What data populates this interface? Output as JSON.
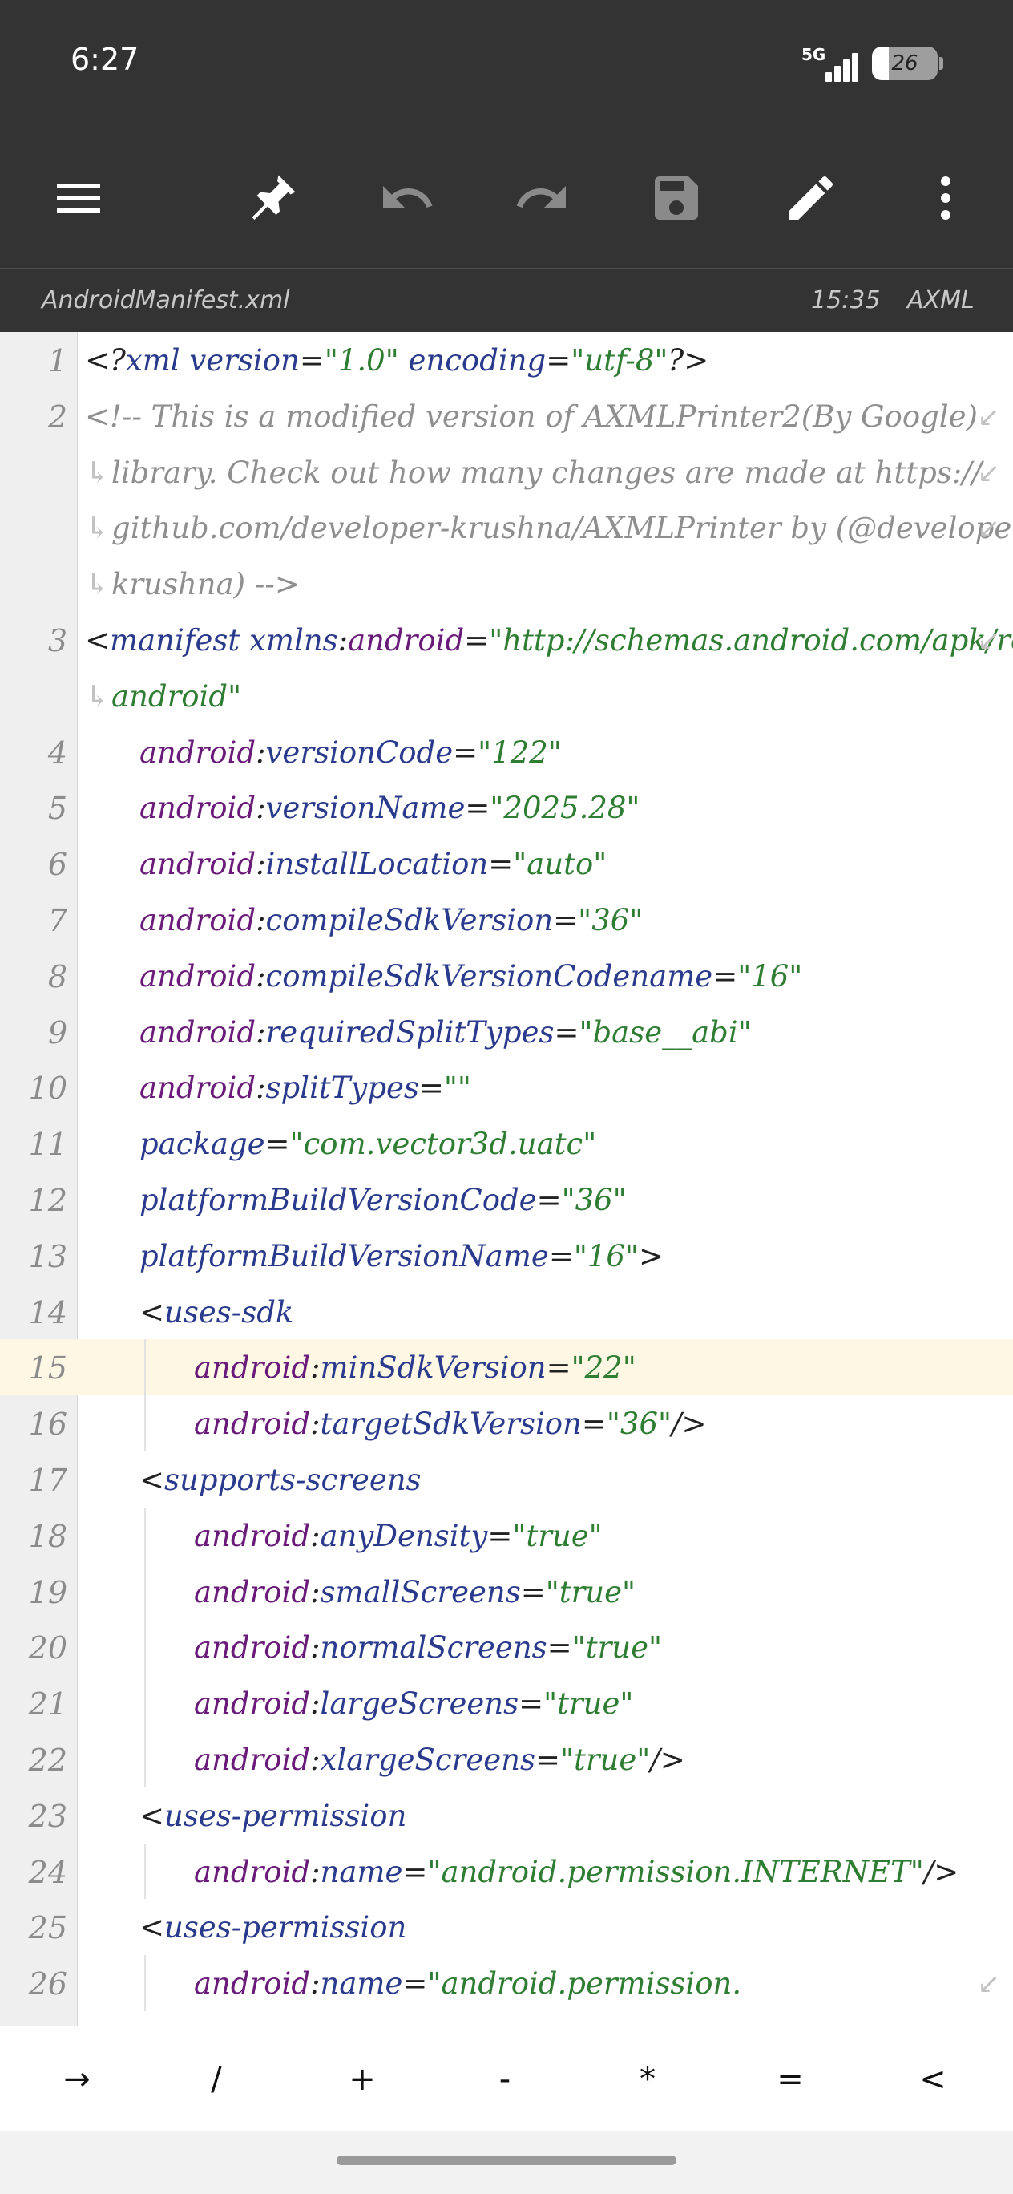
{
  "status_bar": {
    "time": "6:27",
    "network": "5G",
    "battery_level": "26",
    "battery_fraction": 0.26
  },
  "toolbar": {
    "icons": [
      "menu-icon",
      "pin-icon",
      "undo-icon",
      "redo-icon",
      "save-icon",
      "edit-icon",
      "more-vert-icon"
    ]
  },
  "file_bar": {
    "file_name": "AndroidManifest.xml",
    "time": "15:35",
    "file_type": "AXML"
  },
  "editor": {
    "current_line": "15",
    "lines": [
      {
        "n": "1",
        "indent": 0,
        "wrap_start": false,
        "wrap_end": false,
        "tokens": [
          {
            "k": "punct",
            "t": "<?"
          },
          {
            "k": "tag",
            "t": "xml "
          },
          {
            "k": "attr",
            "t": "version"
          },
          {
            "k": "punct",
            "t": "="
          },
          {
            "k": "val",
            "t": "\"1.0\""
          },
          {
            "k": "attr",
            "t": " encoding"
          },
          {
            "k": "punct",
            "t": "="
          },
          {
            "k": "val",
            "t": "\"utf-8\""
          },
          {
            "k": "punct",
            "t": "?>"
          }
        ]
      },
      {
        "n": "2",
        "indent": 0,
        "wrap_start": false,
        "wrap_end": true,
        "tokens": [
          {
            "k": "comment",
            "t": "<!-- This is a modified version of AXMLPrinter2(By Google) "
          }
        ]
      },
      {
        "n": "",
        "indent": 0,
        "wrap_start": true,
        "wrap_end": true,
        "tokens": [
          {
            "k": "comment",
            "t": "library. Check out how many changes are made at https://"
          }
        ]
      },
      {
        "n": "",
        "indent": 0,
        "wrap_start": true,
        "wrap_end": true,
        "tokens": [
          {
            "k": "comment",
            "t": "github.com/developer-krushna/AXMLPrinter by (@developer-"
          }
        ]
      },
      {
        "n": "",
        "indent": 0,
        "wrap_start": true,
        "wrap_end": false,
        "tokens": [
          {
            "k": "comment",
            "t": "krushna) -->"
          }
        ]
      },
      {
        "n": "3",
        "indent": 0,
        "wrap_start": false,
        "wrap_end": true,
        "tokens": [
          {
            "k": "punct",
            "t": "<"
          },
          {
            "k": "tag",
            "t": "manifest "
          },
          {
            "k": "attr",
            "t": "xmlns"
          },
          {
            "k": "punct",
            "t": ":"
          },
          {
            "k": "ns",
            "t": "android"
          },
          {
            "k": "punct",
            "t": "="
          },
          {
            "k": "val",
            "t": "\"http://schemas.android.com/apk/res/"
          }
        ]
      },
      {
        "n": "",
        "indent": 0,
        "wrap_start": true,
        "wrap_end": false,
        "tokens": [
          {
            "k": "val",
            "t": "android\""
          }
        ]
      },
      {
        "n": "4",
        "indent": 1,
        "wrap_start": false,
        "wrap_end": false,
        "tokens": [
          {
            "k": "ns",
            "t": "android"
          },
          {
            "k": "punct",
            "t": ":"
          },
          {
            "k": "attr",
            "t": "versionCode"
          },
          {
            "k": "punct",
            "t": "="
          },
          {
            "k": "val",
            "t": "\"122\""
          }
        ]
      },
      {
        "n": "5",
        "indent": 1,
        "wrap_start": false,
        "wrap_end": false,
        "tokens": [
          {
            "k": "ns",
            "t": "android"
          },
          {
            "k": "punct",
            "t": ":"
          },
          {
            "k": "attr",
            "t": "versionName"
          },
          {
            "k": "punct",
            "t": "="
          },
          {
            "k": "val",
            "t": "\"2025.28\""
          }
        ]
      },
      {
        "n": "6",
        "indent": 1,
        "wrap_start": false,
        "wrap_end": false,
        "tokens": [
          {
            "k": "ns",
            "t": "android"
          },
          {
            "k": "punct",
            "t": ":"
          },
          {
            "k": "attr",
            "t": "installLocation"
          },
          {
            "k": "punct",
            "t": "="
          },
          {
            "k": "val",
            "t": "\"auto\""
          }
        ]
      },
      {
        "n": "7",
        "indent": 1,
        "wrap_start": false,
        "wrap_end": false,
        "tokens": [
          {
            "k": "ns",
            "t": "android"
          },
          {
            "k": "punct",
            "t": ":"
          },
          {
            "k": "attr",
            "t": "compileSdkVersion"
          },
          {
            "k": "punct",
            "t": "="
          },
          {
            "k": "val",
            "t": "\"36\""
          }
        ]
      },
      {
        "n": "8",
        "indent": 1,
        "wrap_start": false,
        "wrap_end": false,
        "tokens": [
          {
            "k": "ns",
            "t": "android"
          },
          {
            "k": "punct",
            "t": ":"
          },
          {
            "k": "attr",
            "t": "compileSdkVersionCodename"
          },
          {
            "k": "punct",
            "t": "="
          },
          {
            "k": "val",
            "t": "\"16\""
          }
        ]
      },
      {
        "n": "9",
        "indent": 1,
        "wrap_start": false,
        "wrap_end": false,
        "tokens": [
          {
            "k": "ns",
            "t": "android"
          },
          {
            "k": "punct",
            "t": ":"
          },
          {
            "k": "attr",
            "t": "requiredSplitTypes"
          },
          {
            "k": "punct",
            "t": "="
          },
          {
            "k": "val",
            "t": "\"base__abi\""
          }
        ]
      },
      {
        "n": "10",
        "indent": 1,
        "wrap_start": false,
        "wrap_end": false,
        "tokens": [
          {
            "k": "ns",
            "t": "android"
          },
          {
            "k": "punct",
            "t": ":"
          },
          {
            "k": "attr",
            "t": "splitTypes"
          },
          {
            "k": "punct",
            "t": "="
          },
          {
            "k": "val",
            "t": "\"\""
          }
        ]
      },
      {
        "n": "11",
        "indent": 1,
        "wrap_start": false,
        "wrap_end": false,
        "tokens": [
          {
            "k": "attr",
            "t": "package"
          },
          {
            "k": "punct",
            "t": "="
          },
          {
            "k": "val",
            "t": "\"com.vector3d.uatc\""
          }
        ]
      },
      {
        "n": "12",
        "indent": 1,
        "wrap_start": false,
        "wrap_end": false,
        "tokens": [
          {
            "k": "attr",
            "t": "platformBuildVersionCode"
          },
          {
            "k": "punct",
            "t": "="
          },
          {
            "k": "val",
            "t": "\"36\""
          }
        ]
      },
      {
        "n": "13",
        "indent": 1,
        "wrap_start": false,
        "wrap_end": false,
        "tokens": [
          {
            "k": "attr",
            "t": "platformBuildVersionName"
          },
          {
            "k": "punct",
            "t": "="
          },
          {
            "k": "val",
            "t": "\"16\""
          },
          {
            "k": "punct",
            "t": ">"
          }
        ]
      },
      {
        "n": "14",
        "indent": 1,
        "wrap_start": false,
        "wrap_end": false,
        "tokens": [
          {
            "k": "punct",
            "t": "<"
          },
          {
            "k": "tag",
            "t": "uses-sdk"
          }
        ]
      },
      {
        "n": "15",
        "indent": 2,
        "wrap_start": false,
        "wrap_end": false,
        "tokens": [
          {
            "k": "ns",
            "t": "android"
          },
          {
            "k": "punct",
            "t": ":"
          },
          {
            "k": "attr",
            "t": "minSdkVersion"
          },
          {
            "k": "punct",
            "t": "="
          },
          {
            "k": "val",
            "t": "\"22\""
          }
        ]
      },
      {
        "n": "16",
        "indent": 2,
        "wrap_start": false,
        "wrap_end": false,
        "tokens": [
          {
            "k": "ns",
            "t": "android"
          },
          {
            "k": "punct",
            "t": ":"
          },
          {
            "k": "attr",
            "t": "targetSdkVersion"
          },
          {
            "k": "punct",
            "t": "="
          },
          {
            "k": "val",
            "t": "\"36\""
          },
          {
            "k": "punct",
            "t": "/>"
          }
        ]
      },
      {
        "n": "17",
        "indent": 1,
        "wrap_start": false,
        "wrap_end": false,
        "tokens": [
          {
            "k": "punct",
            "t": "<"
          },
          {
            "k": "tag",
            "t": "supports-screens"
          }
        ]
      },
      {
        "n": "18",
        "indent": 2,
        "wrap_start": false,
        "wrap_end": false,
        "tokens": [
          {
            "k": "ns",
            "t": "android"
          },
          {
            "k": "punct",
            "t": ":"
          },
          {
            "k": "attr",
            "t": "anyDensity"
          },
          {
            "k": "punct",
            "t": "="
          },
          {
            "k": "val",
            "t": "\"true\""
          }
        ]
      },
      {
        "n": "19",
        "indent": 2,
        "wrap_start": false,
        "wrap_end": false,
        "tokens": [
          {
            "k": "ns",
            "t": "android"
          },
          {
            "k": "punct",
            "t": ":"
          },
          {
            "k": "attr",
            "t": "smallScreens"
          },
          {
            "k": "punct",
            "t": "="
          },
          {
            "k": "val",
            "t": "\"true\""
          }
        ]
      },
      {
        "n": "20",
        "indent": 2,
        "wrap_start": false,
        "wrap_end": false,
        "tokens": [
          {
            "k": "ns",
            "t": "android"
          },
          {
            "k": "punct",
            "t": ":"
          },
          {
            "k": "attr",
            "t": "normalScreens"
          },
          {
            "k": "punct",
            "t": "="
          },
          {
            "k": "val",
            "t": "\"true\""
          }
        ]
      },
      {
        "n": "21",
        "indent": 2,
        "wrap_start": false,
        "wrap_end": false,
        "tokens": [
          {
            "k": "ns",
            "t": "android"
          },
          {
            "k": "punct",
            "t": ":"
          },
          {
            "k": "attr",
            "t": "largeScreens"
          },
          {
            "k": "punct",
            "t": "="
          },
          {
            "k": "val",
            "t": "\"true\""
          }
        ]
      },
      {
        "n": "22",
        "indent": 2,
        "wrap_start": false,
        "wrap_end": false,
        "tokens": [
          {
            "k": "ns",
            "t": "android"
          },
          {
            "k": "punct",
            "t": ":"
          },
          {
            "k": "attr",
            "t": "xlargeScreens"
          },
          {
            "k": "punct",
            "t": "="
          },
          {
            "k": "val",
            "t": "\"true\""
          },
          {
            "k": "punct",
            "t": "/>"
          }
        ]
      },
      {
        "n": "23",
        "indent": 1,
        "wrap_start": false,
        "wrap_end": false,
        "tokens": [
          {
            "k": "punct",
            "t": "<"
          },
          {
            "k": "tag",
            "t": "uses-permission"
          }
        ]
      },
      {
        "n": "24",
        "indent": 2,
        "wrap_start": false,
        "wrap_end": false,
        "tokens": [
          {
            "k": "ns",
            "t": "android"
          },
          {
            "k": "punct",
            "t": ":"
          },
          {
            "k": "attr",
            "t": "name"
          },
          {
            "k": "punct",
            "t": "="
          },
          {
            "k": "val",
            "t": "\"android.permission.INTERNET\""
          },
          {
            "k": "punct",
            "t": "/>"
          }
        ]
      },
      {
        "n": "25",
        "indent": 1,
        "wrap_start": false,
        "wrap_end": false,
        "tokens": [
          {
            "k": "punct",
            "t": "<"
          },
          {
            "k": "tag",
            "t": "uses-permission"
          }
        ]
      },
      {
        "n": "26",
        "indent": 2,
        "wrap_start": false,
        "wrap_end": true,
        "tokens": [
          {
            "k": "ns",
            "t": "android"
          },
          {
            "k": "punct",
            "t": ":"
          },
          {
            "k": "attr",
            "t": "name"
          },
          {
            "k": "punct",
            "t": "="
          },
          {
            "k": "val",
            "t": "\"android.permission."
          }
        ]
      }
    ]
  },
  "symbol_bar": {
    "keys": [
      "→",
      "/",
      "+",
      "-",
      "*",
      "=",
      "<"
    ]
  },
  "colors": {
    "toolbar_bg": "#333333",
    "tag": "#2a3a8c",
    "namespace": "#6a1b7a",
    "value": "#2e7d32",
    "comment": "#8f8f8f",
    "current_line_bg": "#fdf7e4"
  }
}
